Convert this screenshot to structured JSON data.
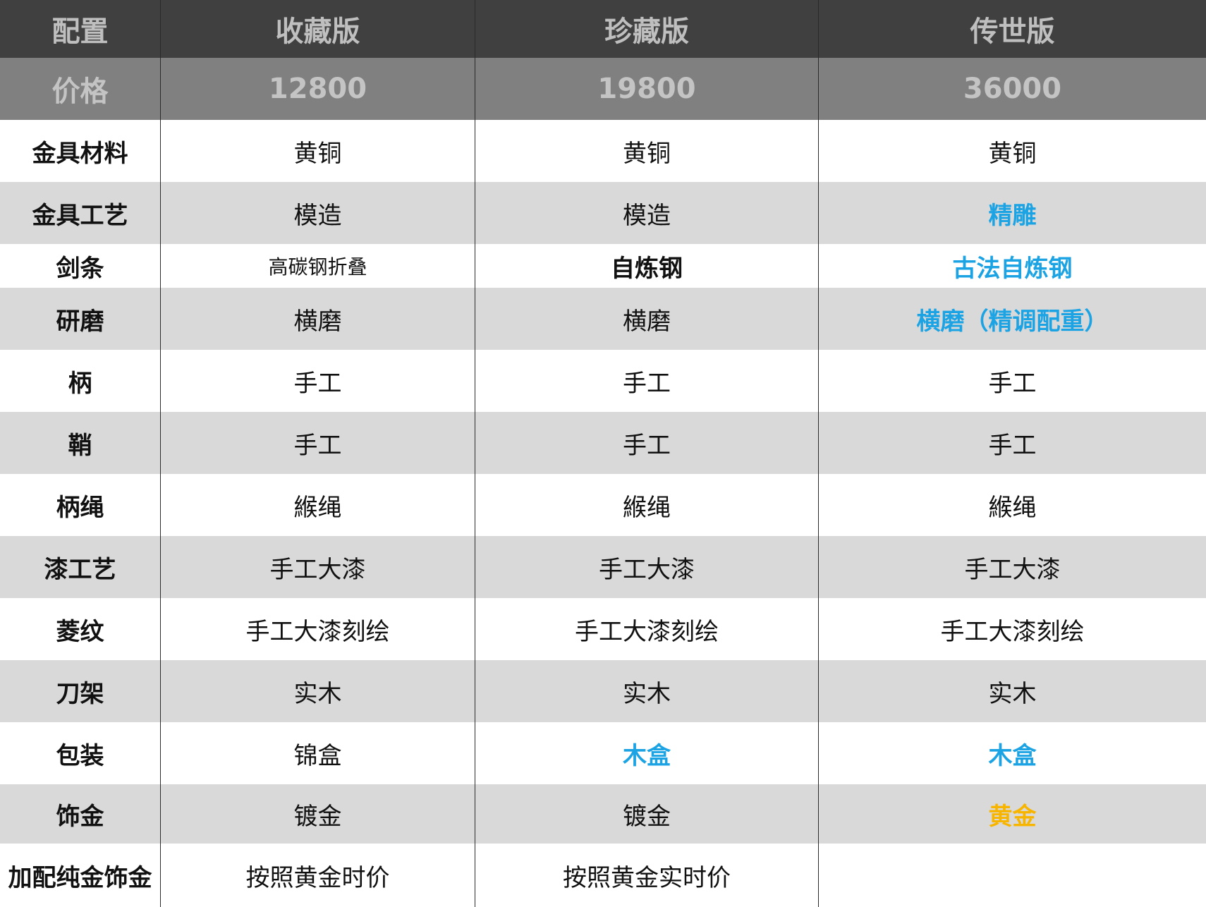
{
  "header": [
    "配置",
    "收藏版",
    "珍藏版",
    "传世版"
  ],
  "price_row": [
    "价格",
    "12800",
    "19800",
    "36000"
  ],
  "rows": [
    {
      "label": "金具材料",
      "cells": [
        "黄铜",
        "黄铜",
        "黄铜"
      ]
    },
    {
      "label": "金具工艺",
      "cells": [
        "模造",
        "模造",
        "精雕"
      ]
    },
    {
      "label": "剑条",
      "cells": [
        "高碳钢折叠",
        "自炼钢",
        "古法自炼钢"
      ]
    },
    {
      "label": "研磨",
      "cells": [
        "横磨",
        "横磨",
        "横磨（精调配重）"
      ]
    },
    {
      "label": "柄",
      "cells": [
        "手工",
        "手工",
        "手工"
      ]
    },
    {
      "label": "鞘",
      "cells": [
        "手工",
        "手工",
        "手工"
      ]
    },
    {
      "label": "柄绳",
      "cells": [
        "緱绳",
        "緱绳",
        "緱绳"
      ]
    },
    {
      "label": "漆工艺",
      "cells": [
        "手工大漆",
        "手工大漆",
        "手工大漆"
      ]
    },
    {
      "label": "菱纹",
      "cells": [
        "手工大漆刻绘",
        "手工大漆刻绘",
        "手工大漆刻绘"
      ]
    },
    {
      "label": "刀架",
      "cells": [
        "实木",
        "实木",
        "实木"
      ]
    },
    {
      "label": "包装",
      "cells": [
        "锦盒",
        "木盒",
        "木盒"
      ]
    },
    {
      "label": "饰金",
      "cells": [
        "镀金",
        "镀金",
        "黄金"
      ]
    },
    {
      "label": "加配纯金饰金",
      "cells": [
        "按照黄金时价",
        "按照黄金实时价",
        ""
      ]
    }
  ],
  "colors": {
    "header_bg": "#404040",
    "price_bg": "#808080",
    "stripe_bg": "#d9d9d9",
    "highlight_blue": "#1ca3e4",
    "highlight_gold": "#f7b500"
  }
}
